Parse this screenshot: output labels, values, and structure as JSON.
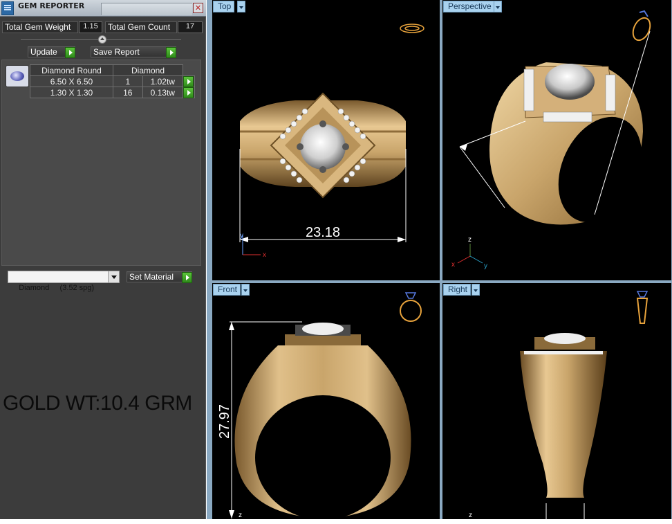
{
  "panel": {
    "title": "GEM REPORTER",
    "close_glyph": "✕",
    "total_gem_weight_label": "Total Gem Weight",
    "total_gem_weight": "1.15",
    "total_gem_count_label": "Total Gem Count",
    "total_gem_count": "17",
    "update_label": "Update",
    "save_report_label": "Save Report",
    "table": {
      "headers": [
        "Diamond Round",
        "Diamond"
      ],
      "rows": [
        {
          "size": "6.50 X 6.50",
          "count": "1",
          "weight": "1.02tw"
        },
        {
          "size": "1.30 X 1.30",
          "count": "16",
          "weight": "0.13tw"
        }
      ]
    },
    "material_select": "Diamond     (3.52 spg)",
    "set_material_label": "Set Material",
    "gold_weight_note": "GOLD WT:10.4 GRM"
  },
  "viewports": {
    "top": {
      "label": "Top",
      "dimension": "23.18",
      "axis_a": "y",
      "axis_b": "x"
    },
    "perspective": {
      "label": "Perspective",
      "axis_z": "z",
      "axis_x": "x",
      "axis_y": "y"
    },
    "front": {
      "label": "Front",
      "dimension": "27.97",
      "axis": "z"
    },
    "right": {
      "label": "Right",
      "axis": "z"
    }
  },
  "colors": {
    "panel_bg": "#3c3c3c",
    "viewport_bg": "#000000",
    "viewport_label_bg": "#a9d2ef",
    "gold": "#c9a56b",
    "go_button": "#3fa824"
  }
}
